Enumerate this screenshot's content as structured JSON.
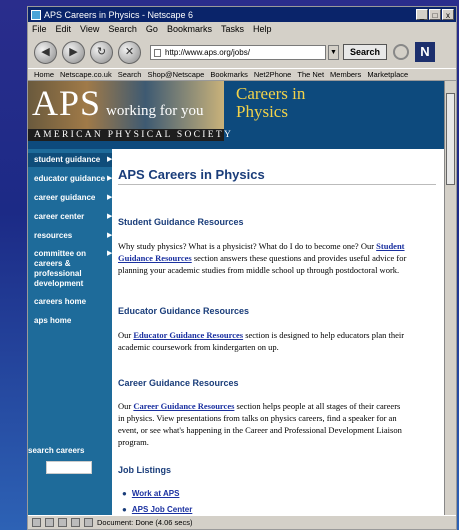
{
  "window": {
    "title": "APS Careers in Physics - Netscape 6",
    "controls": [
      "_",
      "□",
      "x"
    ]
  },
  "menubar": [
    "File",
    "Edit",
    "View",
    "Search",
    "Go",
    "Bookmarks",
    "Tasks",
    "Help"
  ],
  "toolbar": {
    "url": "http://www.aps.org/jobs/",
    "search_label": "Search",
    "logo": "N"
  },
  "personal_toolbar": [
    "Home",
    "Netscape.co.uk",
    "Search",
    "Shop@Netscape",
    "Bookmarks",
    "Net2Phone",
    "The Net",
    "Members",
    "Marketplace"
  ],
  "banner": {
    "logo_text": "APS",
    "tagline": "working for you",
    "society": "AMERICAN PHYSICAL SOCIETY",
    "heading_line1": "Careers in",
    "heading_line2": "Physics"
  },
  "sidebar": {
    "items": [
      {
        "label": "student guidance"
      },
      {
        "label": "educator guidance"
      },
      {
        "label": "career guidance"
      },
      {
        "label": "career center"
      },
      {
        "label": "resources"
      },
      {
        "label": "committee on careers & professional development"
      },
      {
        "label": "careers home"
      },
      {
        "label": "aps home"
      }
    ],
    "search_label": "search careers",
    "search_placeholder": ""
  },
  "main": {
    "title": "APS Careers in Physics",
    "sections": [
      {
        "heading": "Student Guidance Resources",
        "pre": "Why study physics? What is a physicist? What do I do to become one? Our ",
        "link": "Student Guidance Resources",
        "post": " section answers these questions and provides useful advice for planning your academic studies from middle school up through postdoctoral work."
      },
      {
        "heading": "Educator Guidance Resources",
        "pre": "Our ",
        "link": "Educator Guidance Resources",
        "post": " section is designed to help educators plan their academic coursework from kindergarten on up."
      },
      {
        "heading": "Career Guidance Resources",
        "pre": "Our ",
        "link": "Career Guidance Resources",
        "post": " section helps people at all stages of their careers in physics.  View presentations from talks on physics careers, find a speaker for an event, or see what's happening in the Career and Professional Development Liaison program."
      }
    ],
    "job_heading": "Job Listings",
    "job_links": [
      "Work at APS",
      "APS Job Center"
    ]
  },
  "status": {
    "text": "Document: Done (4.06 secs)"
  }
}
